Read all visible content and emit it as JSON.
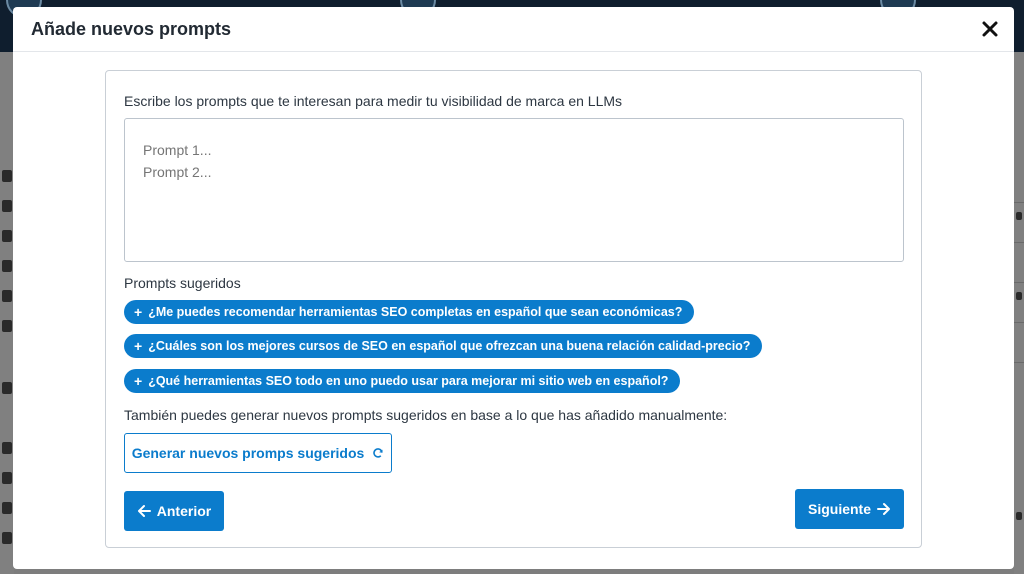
{
  "modal": {
    "title": "Añade nuevos prompts",
    "intro": "Escribe los prompts que te interesan para medir tu visibilidad de marca en LLMs",
    "prompts_placeholder": "Prompt 1...\nPrompt 2...",
    "suggested_label": "Prompts sugeridos",
    "suggestions": [
      "¿Me puedes recomendar herramientas SEO completas en español que sean económicas?",
      "¿Cuáles son los mejores cursos de SEO en español que ofrezcan una buena relación calidad-precio?",
      "¿Qué herramientas SEO todo en uno puedo usar para mejorar mi sitio web en español?"
    ],
    "also_text": "También puedes generar nuevos prompts sugeridos en base a lo que has añadido manualmente:",
    "generate_label": "Generar nuevos promps sugeridos",
    "prev_label": "Anterior",
    "next_label": "Siguiente"
  },
  "icons": {
    "close": "close-icon",
    "plus": "plus-icon",
    "refresh": "refresh-icon",
    "arrow_left": "arrow-left-icon",
    "arrow_right": "arrow-right-icon"
  },
  "colors": {
    "accent": "#0b7ccc",
    "overlay": "#7d7d7d",
    "title_text": "#222a33"
  }
}
